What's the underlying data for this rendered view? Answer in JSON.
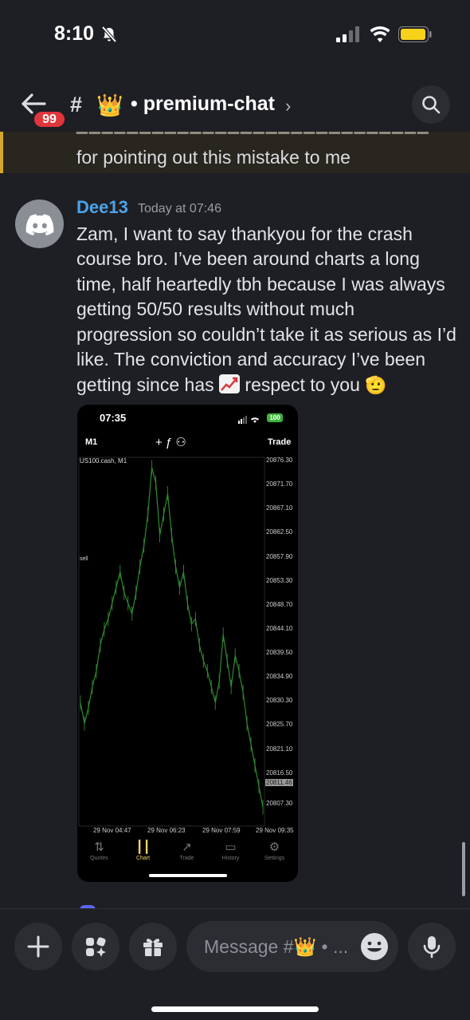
{
  "status_bar": {
    "time": "8:10",
    "battery_color": "#f6d21b"
  },
  "header": {
    "back_badge": "99",
    "channel_prefix": "#",
    "channel_emoji": "👑",
    "channel_name": "• premium-chat",
    "chevron": "›"
  },
  "previous_message": {
    "cut_text": "━━━━━━━━━━━━━━━━━━━━━━━━━━━━",
    "text": "for pointing out this mistake to me"
  },
  "message": {
    "author": "Dee13",
    "author_color": "#4ea3e8",
    "timestamp": "Today at 07:46",
    "lines": [
      "Zam, I want to say thankyou for the crash",
      "course bro. I’ve been around charts a long",
      "time, half heartedly tbh because I was always",
      "getting 50/50 results without much",
      "progression so couldn’t take it as serious as I’d",
      "like. The conviction and accuracy I’ve been"
    ],
    "last_line_start": "getting since has",
    "last_line_mid": "respect to you",
    "emoji_chart": "chart-increasing",
    "emoji_salute": "🫡"
  },
  "attachment": {
    "time": "07:35",
    "battery": "100",
    "timeframe": "M1",
    "tools": "+   ƒ   ⚇",
    "trade_label": "Trade",
    "symbol": "US100.cash, M1",
    "sell_label": "sell",
    "prices": [
      "20876.30",
      "20871.70",
      "20867.10",
      "20862.50",
      "20857.90",
      "20853.30",
      "20848.70",
      "20844.10",
      "20839.50",
      "20834.90",
      "20830.30",
      "20825.70",
      "20821.10",
      "20816.50"
    ],
    "current_price": "20811.46",
    "low_price": "20807.30",
    "x_labels": [
      "29 Nov 04:47",
      "29 Nov 06:23",
      "29 Nov 07:59",
      "29 Nov 09:35"
    ],
    "nav": [
      {
        "label": "Quotes",
        "icon": "quotes-icon"
      },
      {
        "label": "Chart",
        "icon": "chart-icon"
      },
      {
        "label": "Trade",
        "icon": "trade-icon"
      },
      {
        "label": "History",
        "icon": "history-icon"
      },
      {
        "label": "Settings",
        "icon": "settings-icon",
        "badge": "1"
      }
    ],
    "chart_data": {
      "type": "line",
      "xlabel": "",
      "ylabel": "",
      "x_ticks": [
        "29 Nov 04:47",
        "29 Nov 06:23",
        "29 Nov 07:59",
        "29 Nov 09:35"
      ],
      "ylim": [
        20807.3,
        20876.3
      ],
      "series": [
        {
          "color": "#2e8b2e",
          "values": [
            20830,
            20826,
            20829,
            20833,
            20836,
            20841,
            20844,
            20846,
            20849,
            20852,
            20855,
            20851,
            20849,
            20847,
            20851,
            20856,
            20860,
            20866,
            20875,
            20872,
            20862,
            20866,
            20870,
            20862,
            20856,
            20852,
            20855,
            20849,
            20845,
            20846,
            20841,
            20838,
            20836,
            20833,
            20830,
            20834,
            20843,
            20838,
            20833,
            20839,
            20836,
            20832,
            20826,
            20822,
            20818,
            20814,
            20810
          ]
        }
      ]
    }
  },
  "composer": {
    "placeholder": "Message #👑 • ..."
  }
}
